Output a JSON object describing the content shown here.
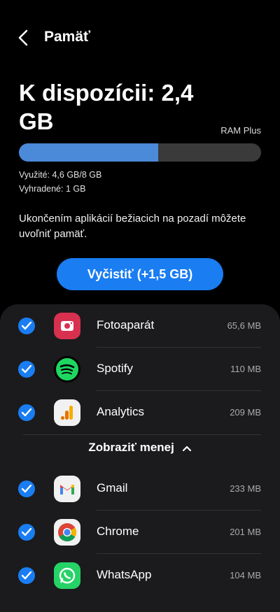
{
  "header": {
    "title": "Pamäť"
  },
  "summary": {
    "available_label": "K dispozícii: 2,4 GB",
    "ram_plus_label": "RAM Plus",
    "usage_fraction": 0.575,
    "used_text": "Využité: 4,6 GB/8 GB",
    "reserved_text": "Vyhradené: 1 GB"
  },
  "description": "Ukončením aplikácií bežiacich na pozadí môžete uvoľniť pamäť.",
  "clean_button": {
    "label": "Vyčistiť (+1,5 GB)"
  },
  "apps_top": [
    {
      "name": "Fotoaparát",
      "size": "65,6 MB",
      "icon": "camera-icon",
      "checked": true
    },
    {
      "name": "Spotify",
      "size": "110 MB",
      "icon": "spotify-icon",
      "checked": true
    },
    {
      "name": "Analytics",
      "size": "209 MB",
      "icon": "analytics-icon",
      "checked": true
    }
  ],
  "show_less_label": "Zobraziť menej",
  "apps_bottom": [
    {
      "name": "Gmail",
      "size": "233 MB",
      "icon": "gmail-icon",
      "checked": true
    },
    {
      "name": "Chrome",
      "size": "201 MB",
      "icon": "chrome-icon",
      "checked": true
    },
    {
      "name": "WhatsApp",
      "size": "104 MB",
      "icon": "whatsapp-icon",
      "checked": true
    }
  ],
  "colors": {
    "accent": "#1a7df2",
    "bar_fill": "#4a8ad9",
    "panel": "#1b1b1d"
  }
}
